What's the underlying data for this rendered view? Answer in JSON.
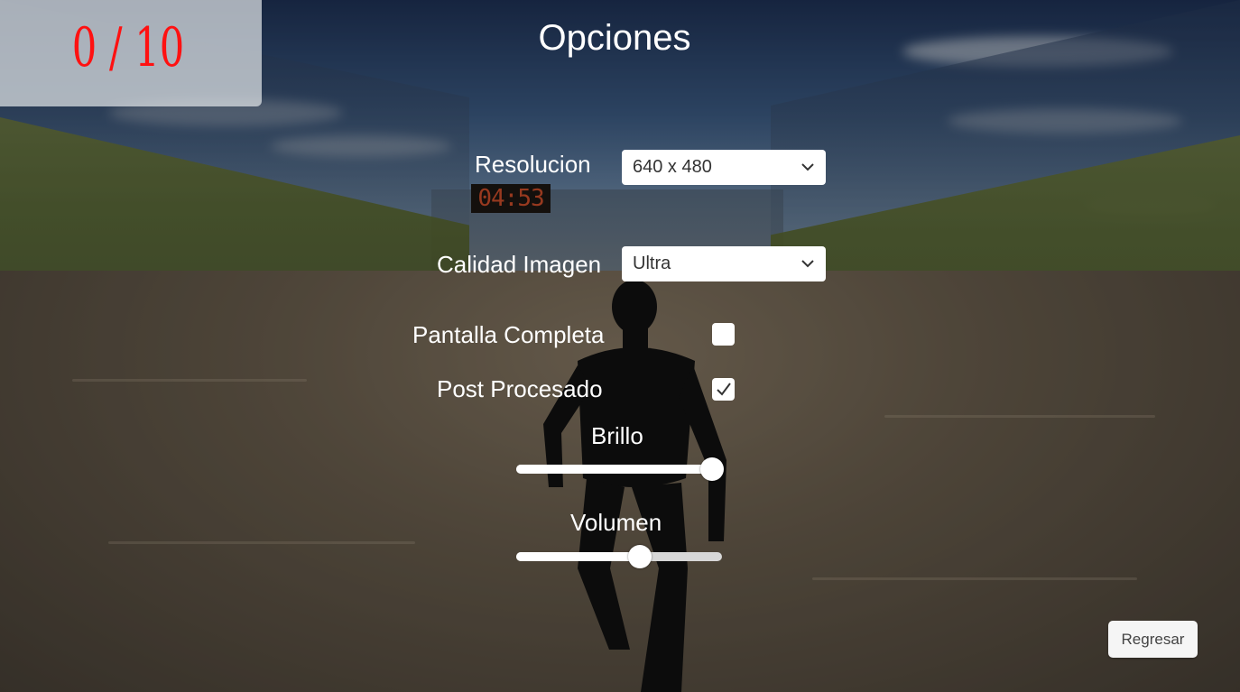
{
  "hud": {
    "score": "0 / 10",
    "timer": "04:53"
  },
  "menu": {
    "title": "Opciones",
    "resolution": {
      "label": "Resolucion",
      "value": "640 x 480"
    },
    "quality": {
      "label": "Calidad Imagen",
      "value": "Ultra"
    },
    "fullscreen": {
      "label": "Pantalla Completa",
      "checked": false
    },
    "postprocess": {
      "label": "Post Procesado",
      "checked": true
    },
    "brightness": {
      "label": "Brillo",
      "level": 0.95
    },
    "volume": {
      "label": "Volumen",
      "level": 0.6
    },
    "back_button": "Regresar"
  },
  "icons": {
    "dropdown": "chevron-down-icon",
    "check": "checkmark-icon"
  },
  "colors": {
    "score": "#ff1111",
    "timer": "#d2502c",
    "panel": "#e1e4e8"
  }
}
